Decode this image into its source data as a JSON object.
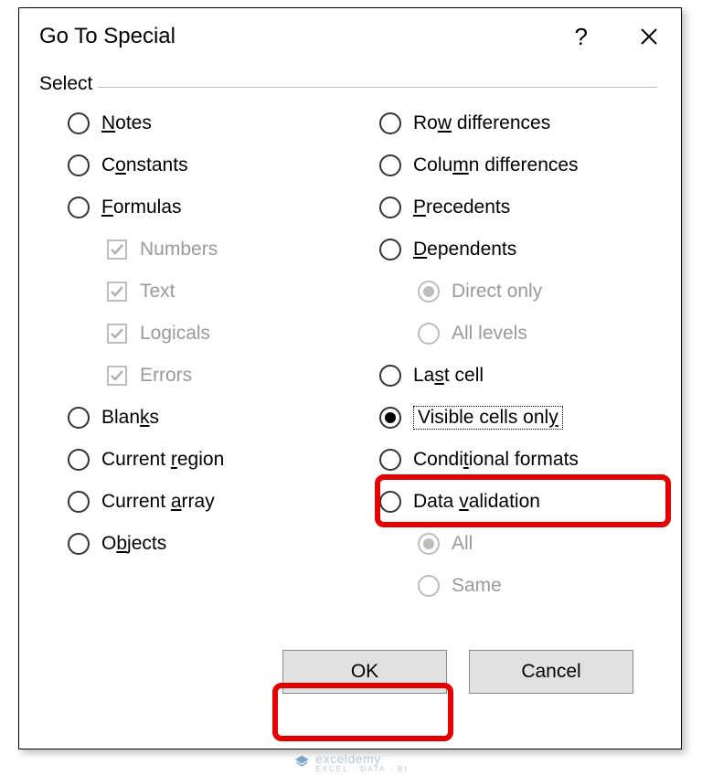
{
  "dialog": {
    "title": "Go To Special",
    "help_symbol": "?",
    "group_label": "Select"
  },
  "left": {
    "notes": {
      "pre": "",
      "u": "N",
      "post": "otes"
    },
    "constants": {
      "pre": "C",
      "u": "o",
      "post": "nstants"
    },
    "formulas": {
      "pre": "",
      "u": "F",
      "post": "ormulas"
    },
    "numbers": {
      "text": "Numbers"
    },
    "text": {
      "text": "Text"
    },
    "logicals": {
      "text": "Logicals"
    },
    "errors": {
      "text": "Errors"
    },
    "blanks": {
      "pre": "Blan",
      "u": "k",
      "post": "s"
    },
    "current_region": {
      "pre": "Current ",
      "u": "r",
      "post": "egion"
    },
    "current_array": {
      "pre": "Current ",
      "u": "a",
      "post": "rray"
    },
    "objects": {
      "pre": "O",
      "u": "b",
      "post": "jects"
    }
  },
  "right": {
    "row_diff": {
      "pre": "Ro",
      "u": "w",
      "post": " differences"
    },
    "col_diff": {
      "pre": "Colu",
      "u": "m",
      "post": "n differences"
    },
    "precedents": {
      "pre": "",
      "u": "P",
      "post": "recedents"
    },
    "dependents": {
      "pre": "",
      "u": "D",
      "post": "ependents"
    },
    "direct_only": {
      "text": "Direct only"
    },
    "all_levels": {
      "text": "All levels"
    },
    "last_cell": {
      "pre": "La",
      "u": "s",
      "post": "t cell"
    },
    "visible": {
      "pre": "Visible cells onl",
      "u": "y",
      "post": ""
    },
    "cond": {
      "pre": "Condi",
      "u": "t",
      "post": "ional formats"
    },
    "datav": {
      "pre": "Data ",
      "u": "v",
      "post": "alidation"
    },
    "all": {
      "text": "All"
    },
    "same": {
      "text": "Same"
    }
  },
  "buttons": {
    "ok": "OK",
    "cancel": "Cancel"
  },
  "watermark": {
    "brand": "exceldemy",
    "tag": "EXCEL · DATA · BI"
  }
}
